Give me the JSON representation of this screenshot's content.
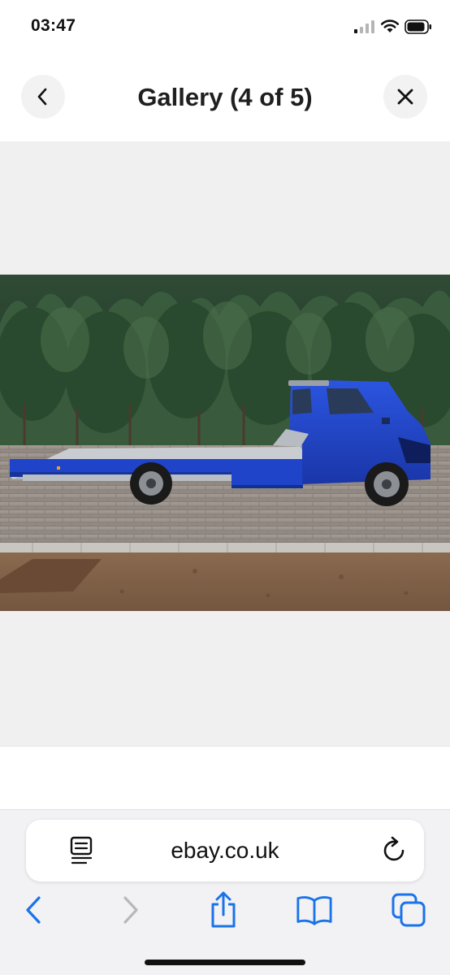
{
  "status": {
    "time": "03:47"
  },
  "header": {
    "title": "Gallery (4 of 5)"
  },
  "browser": {
    "url": "ebay.co.uk"
  },
  "colors": {
    "accent": "#1a73e8",
    "truck_blue": "#1f44c9"
  },
  "icons": {
    "back": "chevron-left-icon",
    "close": "close-icon",
    "reader": "reader-mode-icon",
    "reload": "reload-icon",
    "nav_back": "chevron-left-icon",
    "nav_forward": "chevron-right-icon",
    "share": "share-icon",
    "bookmarks": "book-icon",
    "tabs": "tabs-icon"
  }
}
